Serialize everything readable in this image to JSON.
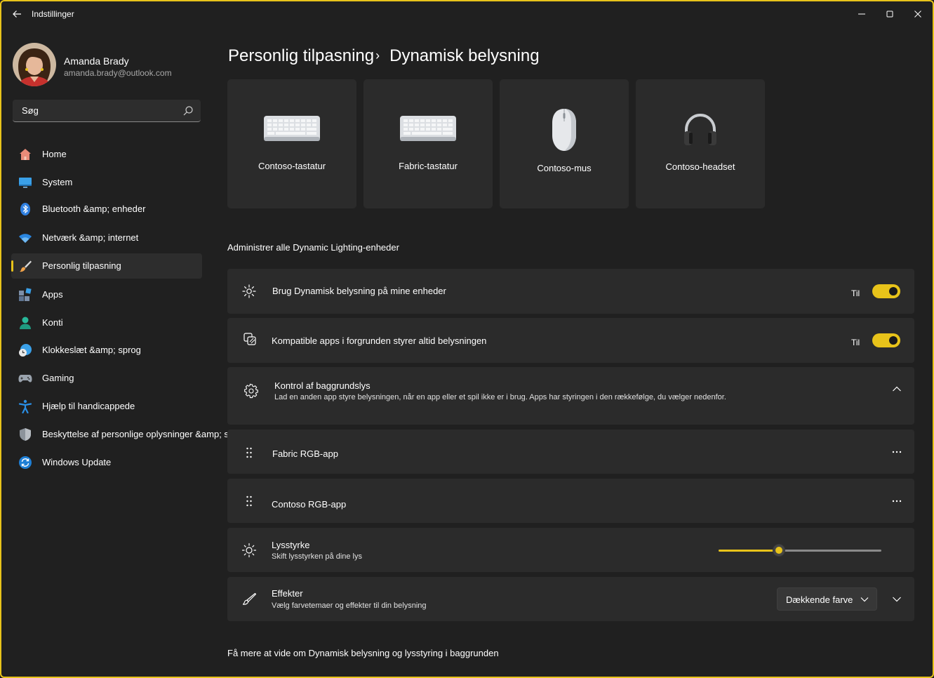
{
  "window": {
    "title": "Indstillinger",
    "accent_color": "#e8c31a",
    "controls": [
      "minimize-icon",
      "maximize-icon",
      "close-icon"
    ]
  },
  "profile": {
    "name": "Amanda Brady",
    "email": "amanda.brady@outlook.com"
  },
  "search": {
    "placeholder": "Søg"
  },
  "sidebar": {
    "items": [
      {
        "label": "Home",
        "icon": "home-icon"
      },
      {
        "label": "System",
        "icon": "monitor-icon"
      },
      {
        "label": "Bluetooth &amp; enheder",
        "icon": "bluetooth-icon"
      },
      {
        "label": "Netværk &amp; internet",
        "icon": "wifi-icon"
      },
      {
        "label": "Personlig tilpasning",
        "icon": "paintbrush-icon",
        "active": true
      },
      {
        "label": "Apps",
        "icon": "apps-icon"
      },
      {
        "label": "Konti",
        "icon": "person-icon"
      },
      {
        "label": "Klokkeslæt &amp; sprog",
        "icon": "clock-globe-icon"
      },
      {
        "label": "Gaming",
        "icon": "gamepad-icon"
      },
      {
        "label": "Hjælp til handicappede",
        "icon": "accessibility-icon"
      },
      {
        "label": "Beskyttelse af personlige oplysninger &amp; sikkerhed",
        "icon": "shield-icon"
      },
      {
        "label": "Windows Update",
        "icon": "update-icon"
      }
    ]
  },
  "breadcrumb": {
    "parent": "Personlig tilpasning",
    "separator": "›",
    "current": "Dynamisk belysning"
  },
  "devices": [
    {
      "label": "Contoso-tastatur",
      "icon": "keyboard-icon"
    },
    {
      "label": "Fabric-tastatur",
      "icon": "keyboard-icon"
    },
    {
      "label": "Contoso-mus",
      "icon": "mouse-icon"
    },
    {
      "label": "Contoso-headset",
      "icon": "headset-icon"
    }
  ],
  "section_title": "Administrer alle Dynamic Lighting-enheder",
  "settings": {
    "use_dynamic": {
      "title": "Brug Dynamisk belysning på mine enheder",
      "state": "Til",
      "on": true,
      "icon": "lighting-icon"
    },
    "compatible_apps": {
      "title": "Kompatible apps i forgrunden styrer altid belysningen",
      "state": "Til",
      "on": true,
      "icon": "app-layers-icon"
    },
    "background_control": {
      "title": "Kontrol af baggrundslys",
      "subtitle": "Lad en anden app styre belysningen, når en app eller et spil ikke er i brug. Apps har styringen i den rækkefølge, du vælger nedenfor.",
      "icon": "gear-icon",
      "expanded": true
    },
    "apps": [
      {
        "title": "Fabric RGB-app"
      },
      {
        "title": "Contoso RGB-app"
      }
    ],
    "brightness": {
      "title": "Lysstyrke",
      "subtitle": "Skift lysstyrken på dine lys",
      "value": 0.37,
      "icon": "sun-icon"
    },
    "effects": {
      "title": "Effekter",
      "subtitle": "Vælg farvetemaer og effekter til din belysning",
      "selected": "Dækkende farve",
      "icon": "pen-icon"
    }
  },
  "learn_more": "Få mere at vide om Dynamisk belysning og lysstyring i baggrunden"
}
